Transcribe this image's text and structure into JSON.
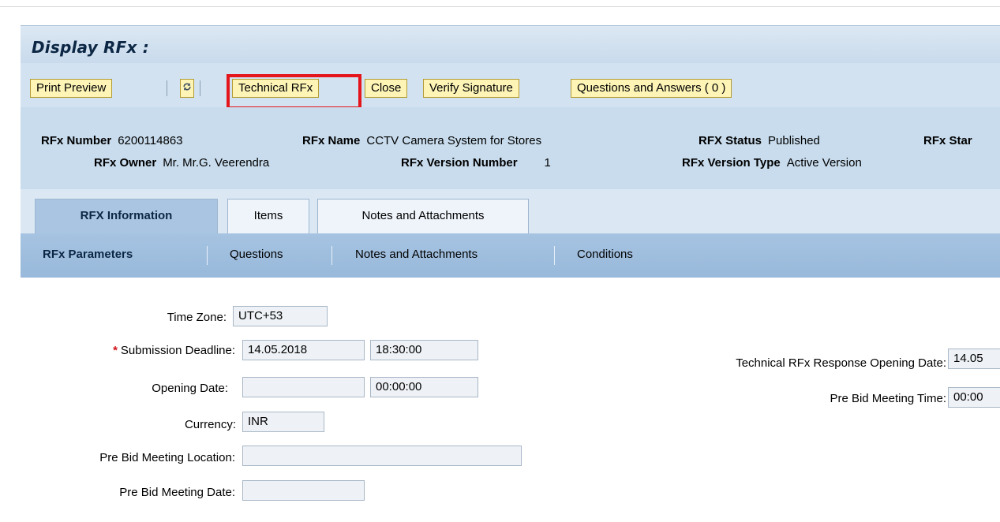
{
  "page": {
    "title": "Display RFx :"
  },
  "toolbar": {
    "print_preview": "Print Preview",
    "refresh_icon": "refresh-icon",
    "technical_rfx": "Technical RFx",
    "close": "Close",
    "verify_signature": "Verify Signature",
    "questions_answers": "Questions and Answers ( 0 )"
  },
  "header": {
    "rfx_number_label": "RFx Number",
    "rfx_number_value": "6200114863",
    "rfx_name_label": "RFx Name",
    "rfx_name_value": "CCTV Camera System for Stores",
    "rfx_status_label": "RFX Status",
    "rfx_status_value": "Published",
    "rfx_start_label": "RFx Star",
    "rfx_owner_label": "RFx Owner",
    "rfx_owner_value": "Mr. Mr.G. Veerendra",
    "rfx_version_number_label": "RFx Version Number",
    "rfx_version_number_value": "1",
    "rfx_version_type_label": "RFx Version Type",
    "rfx_version_type_value": "Active Version"
  },
  "tabs": [
    {
      "label": "RFX Information",
      "active": true
    },
    {
      "label": "Items",
      "active": false
    },
    {
      "label": "Notes and Attachments",
      "active": false
    }
  ],
  "subnav": [
    {
      "label": "RFx Parameters",
      "active": true
    },
    {
      "label": "Questions",
      "active": false
    },
    {
      "label": "Notes and Attachments",
      "active": false
    },
    {
      "label": "Conditions",
      "active": false
    }
  ],
  "form": {
    "time_zone_label": "Time Zone:",
    "time_zone_value": "UTC+53",
    "submission_deadline_label": "Submission Deadline:",
    "submission_deadline_date": "14.05.2018",
    "submission_deadline_time": "18:30:00",
    "opening_date_label": "Opening Date:",
    "opening_date_date": "",
    "opening_date_time": "00:00:00",
    "currency_label": "Currency:",
    "currency_value": "INR",
    "pre_bid_location_label": "Pre Bid Meeting Location:",
    "pre_bid_location_value": "",
    "pre_bid_date_label": "Pre Bid Meeting Date:",
    "pre_bid_date_value": "",
    "technical_opening_label": "Technical RFx Response Opening Date:",
    "technical_opening_value": "14.05",
    "pre_bid_time_label": "Pre Bid Meeting Time:",
    "pre_bid_time_value": "00:00"
  },
  "colors": {
    "button_fill": "#fdf4b6",
    "highlight": "#e4151b",
    "required": "#d0121b",
    "title": "#0c2744"
  }
}
